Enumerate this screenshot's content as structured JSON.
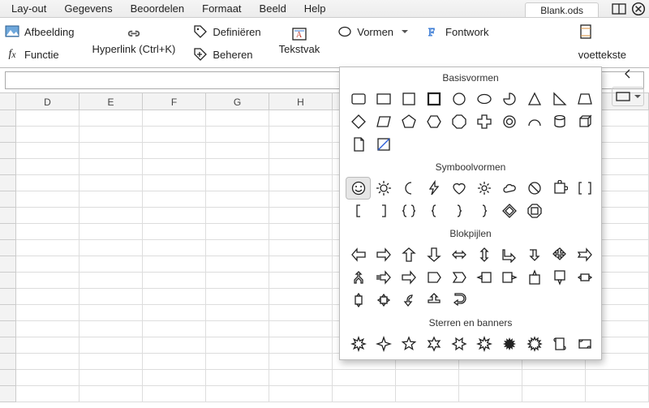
{
  "file_tab": "Blank.ods",
  "menus": [
    "Lay-out",
    "Gegevens",
    "Beoordelen",
    "Formaat",
    "Beeld",
    "Help"
  ],
  "toolbar": {
    "afbeelding": "Afbeelding",
    "functie": "Functie",
    "hyperlink": "Hyperlink (Ctrl+K)",
    "definieren": "Definiëren",
    "beheren": "Beheren",
    "tekstvak": "Tekstvak",
    "vormen": "Vormen",
    "fontwork": "Fontwork",
    "voettekst": "voettekste"
  },
  "columns": [
    "D",
    "E",
    "F",
    "G",
    "H"
  ],
  "shapes_panel": {
    "sections": [
      {
        "title": "Basisvormen",
        "shape_names": [
          "rect-rounded",
          "rect",
          "square",
          "square-thick",
          "circle",
          "ellipse",
          "circle-segment",
          "triangle",
          "right-triangle",
          "trapezoid",
          "diamond",
          "parallelogram",
          "pentagon",
          "hexagon",
          "octagon",
          "plus",
          "ring",
          "arc",
          "cylinder",
          "cube",
          "page",
          "diagonal-rect"
        ]
      },
      {
        "title": "Symboolvormen",
        "shape_names": [
          "smiley",
          "sun",
          "moon",
          "lightning",
          "heart",
          "gear",
          "cloud",
          "no-entry",
          "puzzle",
          "brackets-square",
          "bracket-left",
          "bracket-right",
          "braces",
          "brace-left",
          "brace-right",
          "brace-right2",
          "diamond-bevel",
          "octagon-bevel"
        ]
      },
      {
        "title": "Blokpijlen",
        "shape_names": [
          "arrow-left",
          "arrow-right",
          "arrow-up",
          "arrow-down",
          "arrow-leftright",
          "arrow-updown",
          "arrow-corner-right",
          "arrow-corner-down",
          "arrow-quad",
          "arrow-right-notched",
          "split-arrow",
          "striped-right",
          "pentagon-arrow",
          "chevron-home",
          "chevron",
          "callout-left",
          "callout-right",
          "callout-up",
          "callout-down",
          "callout-leftright",
          "callout-updown",
          "callout-quad",
          "arrow-curve-left",
          "arrow-t-up",
          "arrow-s"
        ]
      },
      {
        "title": "Sterren en banners",
        "shape_names": [
          "explosion1",
          "star4",
          "star5",
          "star6a",
          "star6b",
          "star8",
          "explosion2",
          "star12",
          "scroll-v",
          "scroll-h"
        ]
      }
    ],
    "selected": "smiley"
  },
  "right": {
    "toolbar_dropdown": "▾",
    "label": ""
  }
}
